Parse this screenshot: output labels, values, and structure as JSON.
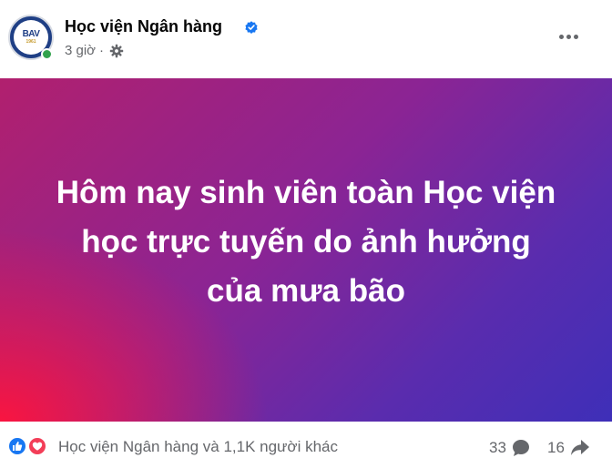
{
  "header": {
    "page_name": "Học viện Ngân hàng",
    "avatar_text": "BAV",
    "avatar_year": "1961",
    "time": "3 giờ",
    "separator": "·",
    "icons": [
      "verified-badge-icon",
      "gear-icon",
      "more-options-icon"
    ]
  },
  "banner": {
    "text": "Hôm nay sinh viên toàn Học viện học trực tuyến do ảnh hưởng của mưa bão",
    "colors": {
      "left": "#ff143c",
      "mid": "#8b2494",
      "right": "#3e2fb8"
    }
  },
  "footer": {
    "reactions_text": "Học viện Ngân hàng và 1,1K người khác",
    "comments_count": "33",
    "shares_count": "16",
    "icons": [
      "like-icon",
      "love-icon",
      "comment-icon",
      "share-icon"
    ]
  },
  "colors": {
    "verified": "#1877f2",
    "secondary_text": "#65676b",
    "like": "#1877f2",
    "love": "#f33e58"
  }
}
